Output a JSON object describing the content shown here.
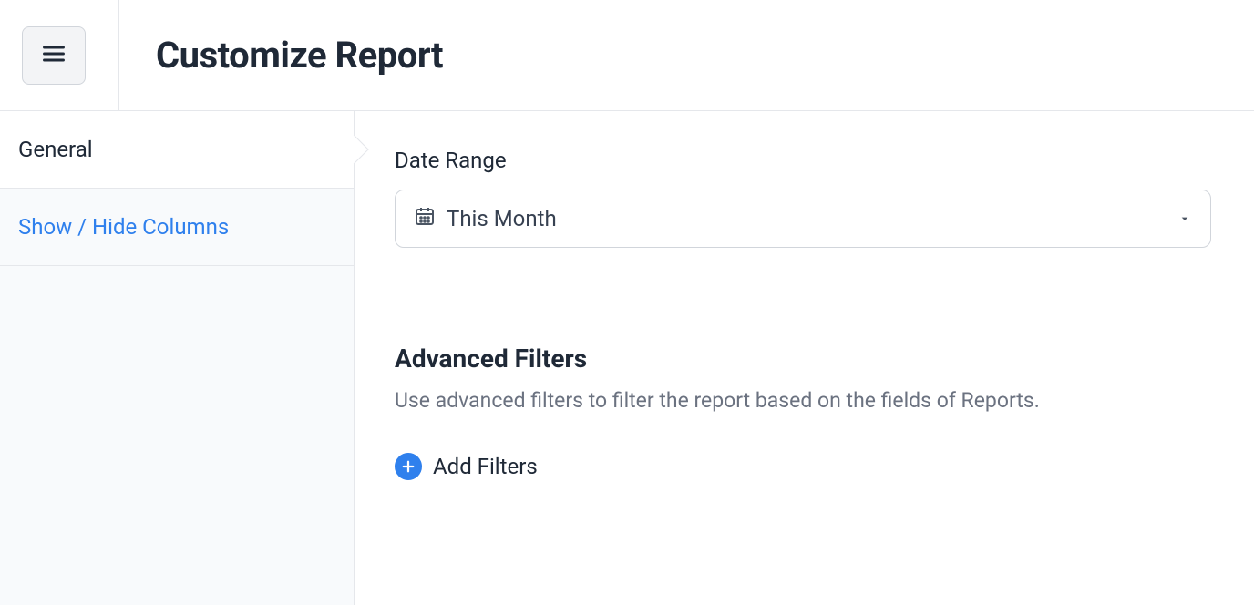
{
  "header": {
    "title": "Customize Report"
  },
  "sidebar": {
    "items": [
      {
        "label": "General",
        "active": true
      },
      {
        "label": "Show / Hide Columns",
        "active": false
      }
    ]
  },
  "main": {
    "date_range": {
      "label": "Date Range",
      "value": "This Month"
    },
    "advanced_filters": {
      "heading": "Advanced Filters",
      "description": "Use advanced filters to filter the report based on the fields of Reports.",
      "add_label": "Add Filters"
    }
  },
  "icons": {
    "menu": "hamburger-icon",
    "calendar": "calendar-icon",
    "caret": "chevron-down-icon",
    "plus": "plus-circle-icon"
  }
}
